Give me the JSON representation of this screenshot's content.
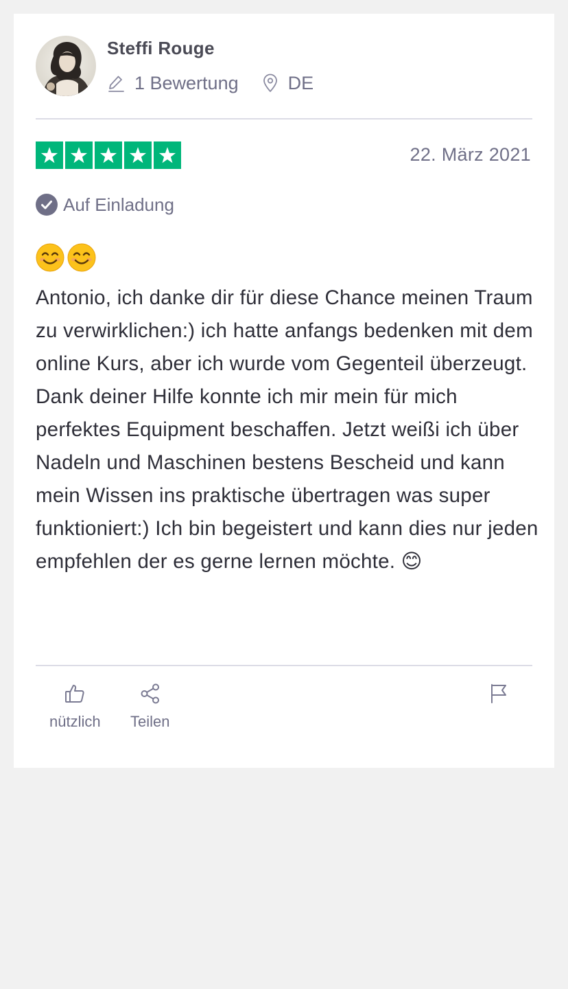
{
  "reviewer": {
    "name": "Steffi Rouge",
    "review_count": "1 Bewertung",
    "country": "DE"
  },
  "review": {
    "rating": 5,
    "max_rating": 5,
    "date": "22. März 2021",
    "verification": "Auf Einladung",
    "emoji_title": "😊😊",
    "body": "Antonio, ich danke dir für diese Chance meinen Traum zu verwirklichen:) ich hatte anfangs bedenken mit dem online Kurs, aber ich wurde vom Gegenteil überzeugt. Dank deiner Hilfe konnte ich mir mein für mich perfektes Equipment beschaffen. Jetzt weißi ich über Nadeln und Maschinen bestens Bescheid und kann mein Wissen ins praktische übertragen was super funktioniert:) Ich bin begeistert und kann dies nur jeden empfehlen der es gerne lernen möchte. 😊"
  },
  "actions": {
    "useful_label": "nützlich",
    "share_label": "Teilen"
  },
  "colors": {
    "star_green": "#00b67a",
    "muted_text": "#6f6f87",
    "body_text": "#2e2e38",
    "background": "#f1f1f1"
  },
  "icons": [
    "pencil-icon",
    "location-pin-icon",
    "star-icon",
    "check-circle-icon",
    "smiley-emoji-icon",
    "thumbs-up-icon",
    "share-icon",
    "flag-icon"
  ]
}
